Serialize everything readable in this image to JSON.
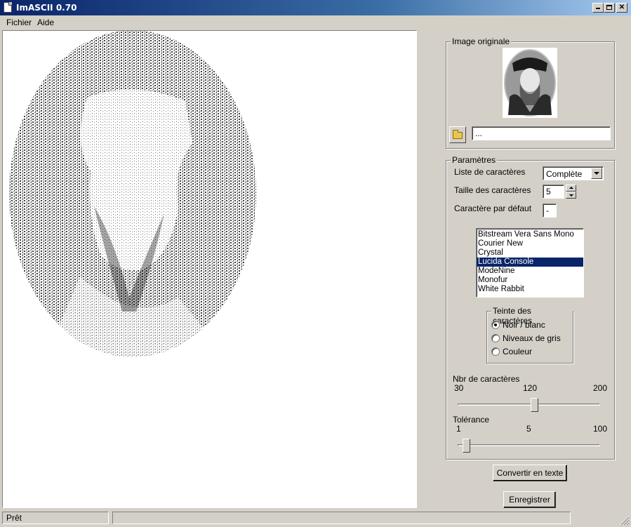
{
  "window": {
    "title": "ImASCII 0.70"
  },
  "menu": {
    "items": [
      "Fichier",
      "Aide"
    ]
  },
  "original_image": {
    "group_label": "Image originale",
    "path_value": "..."
  },
  "params": {
    "group_label": "Paramètres",
    "char_list_label": "Liste de caractères",
    "char_list_value": "Complète",
    "char_size_label": "Taille des caractères",
    "char_size_value": "5",
    "default_char_label": "Caractère par défaut",
    "default_char_value": "-",
    "fonts": [
      "Bitstream Vera Sans Mono",
      "Courier New",
      "Crystal",
      "Lucida Console",
      "ModeNine",
      "Monofur",
      "White Rabbit"
    ],
    "selected_font": "Lucida Console",
    "tint": {
      "group_label": "Teinte des caractères",
      "options": [
        "Noir / blanc",
        "Niveaux de gris",
        "Couleur"
      ],
      "selected": "Noir / blanc"
    },
    "char_count": {
      "label": "Nbr de caractères",
      "min": "30",
      "mid": "120",
      "max": "200",
      "value": 120
    },
    "tolerance": {
      "label": "Tolérance",
      "min": "1",
      "mid": "5",
      "max": "100",
      "value": 4
    }
  },
  "buttons": {
    "convert": "Convertir en texte",
    "save": "Enregistrer"
  },
  "status": {
    "text": "Prêt"
  }
}
